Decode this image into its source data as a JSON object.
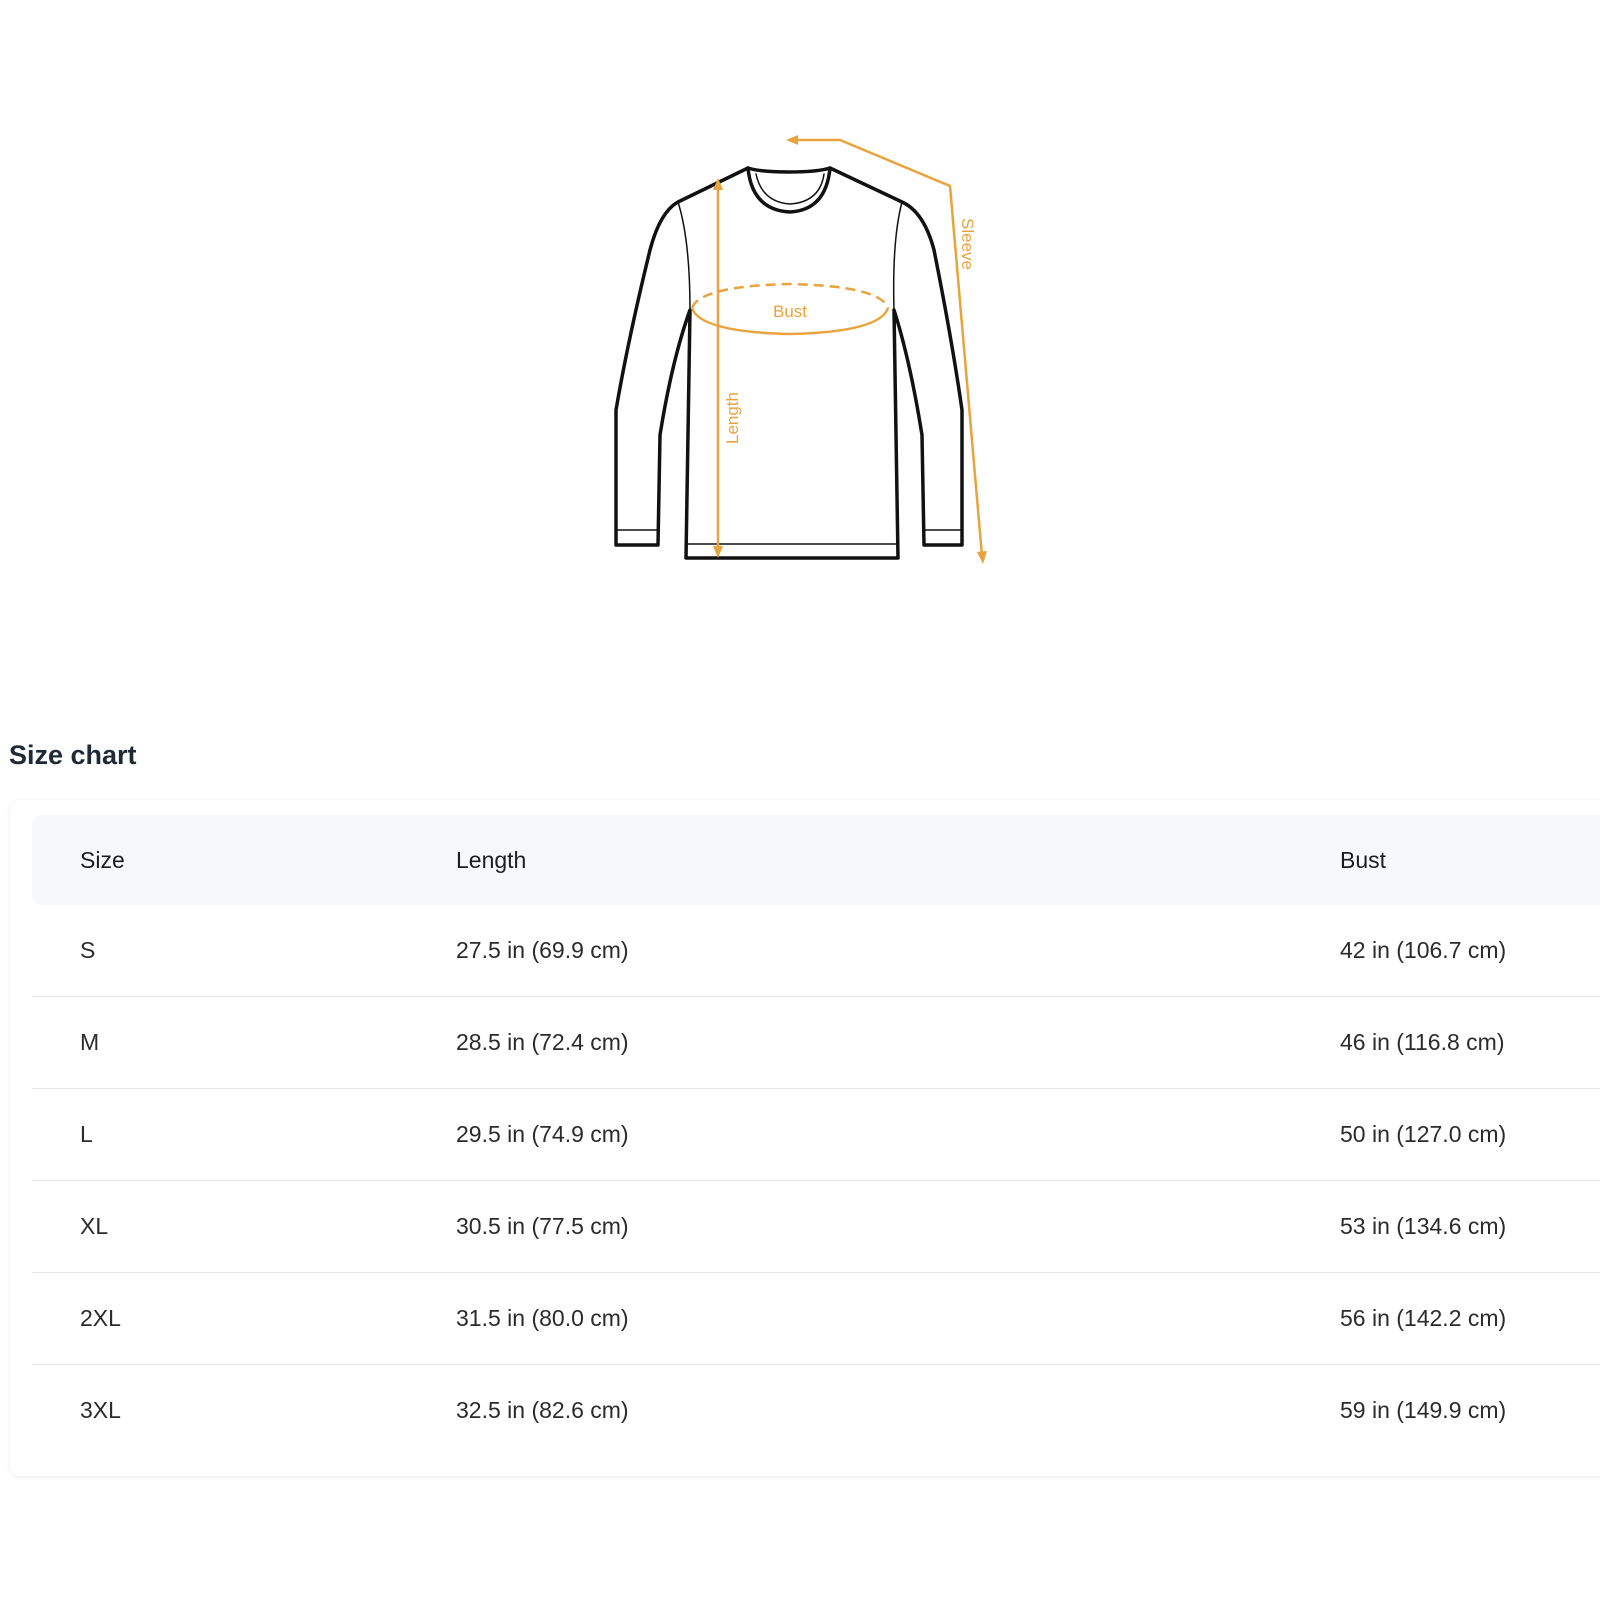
{
  "diagram": {
    "labels": {
      "bust": "Bust",
      "length": "Length",
      "sleeve": "Sleeve"
    },
    "colors": {
      "accent": "#E8A33D",
      "outline": "#111111"
    },
    "icon": "long-sleeve-shirt-icon"
  },
  "size_chart": {
    "title": "Size chart",
    "columns": [
      "Size",
      "Length",
      "Bust"
    ],
    "rows": [
      {
        "size": "S",
        "length": "27.5 in  (69.9 cm)",
        "bust": "42 in  (106.7 cm)"
      },
      {
        "size": "M",
        "length": "28.5 in  (72.4 cm)",
        "bust": "46 in  (116.8 cm)"
      },
      {
        "size": "L",
        "length": "29.5 in  (74.9 cm)",
        "bust": "50 in  (127.0 cm)"
      },
      {
        "size": "XL",
        "length": "30.5 in  (77.5 cm)",
        "bust": "53 in  (134.6 cm)"
      },
      {
        "size": "2XL",
        "length": "31.5 in  (80.0 cm)",
        "bust": "56 in  (142.2 cm)"
      },
      {
        "size": "3XL",
        "length": "32.5 in  (82.6 cm)",
        "bust": "59 in  (149.9 cm)"
      }
    ]
  }
}
